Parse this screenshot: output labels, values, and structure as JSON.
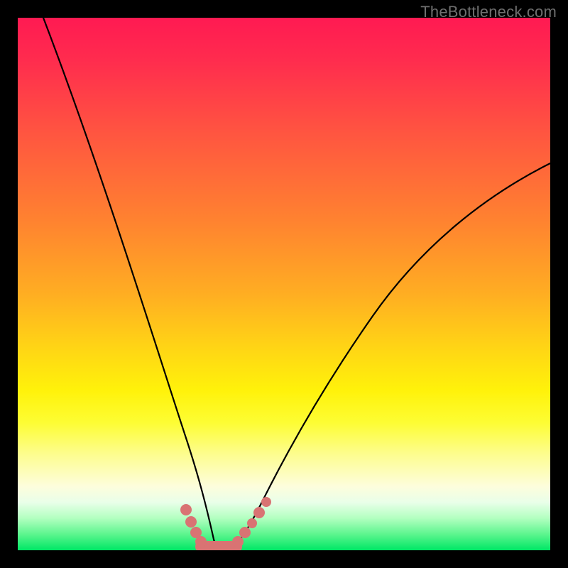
{
  "watermark": "TheBottleneck.com",
  "chart_data": {
    "type": "line",
    "title": "",
    "xlabel": "",
    "ylabel": "",
    "xlim": [
      0,
      100
    ],
    "ylim": [
      0,
      100
    ],
    "series": [
      {
        "name": "left-curve",
        "x": [
          5,
          10,
          15,
          20,
          25,
          28,
          30,
          32,
          33,
          34,
          35
        ],
        "y": [
          100,
          80,
          60,
          40,
          22,
          12,
          7,
          3,
          1.5,
          0.8,
          0.5
        ]
      },
      {
        "name": "right-curve",
        "x": [
          40,
          42,
          44,
          47,
          52,
          60,
          70,
          80,
          90,
          100
        ],
        "y": [
          0.5,
          1.5,
          3,
          7,
          14,
          25,
          40,
          53,
          64,
          73
        ]
      },
      {
        "name": "marker-cluster",
        "type": "scatter",
        "points": [
          {
            "x": 30.5,
            "y": 7.0
          },
          {
            "x": 31.5,
            "y": 4.5
          },
          {
            "x": 32.5,
            "y": 2.5
          },
          {
            "x": 33.5,
            "y": 1.3
          },
          {
            "x": 35.0,
            "y": 0.7
          },
          {
            "x": 37.0,
            "y": 0.6
          },
          {
            "x": 39.0,
            "y": 0.6
          },
          {
            "x": 40.5,
            "y": 1.0
          },
          {
            "x": 42.0,
            "y": 2.0
          },
          {
            "x": 44.0,
            "y": 4.0
          },
          {
            "x": 45.5,
            "y": 6.0
          },
          {
            "x": 47.0,
            "y": 8.0
          }
        ]
      }
    ],
    "accent_marker_color": "#d97373",
    "curve_color": "#000000"
  }
}
